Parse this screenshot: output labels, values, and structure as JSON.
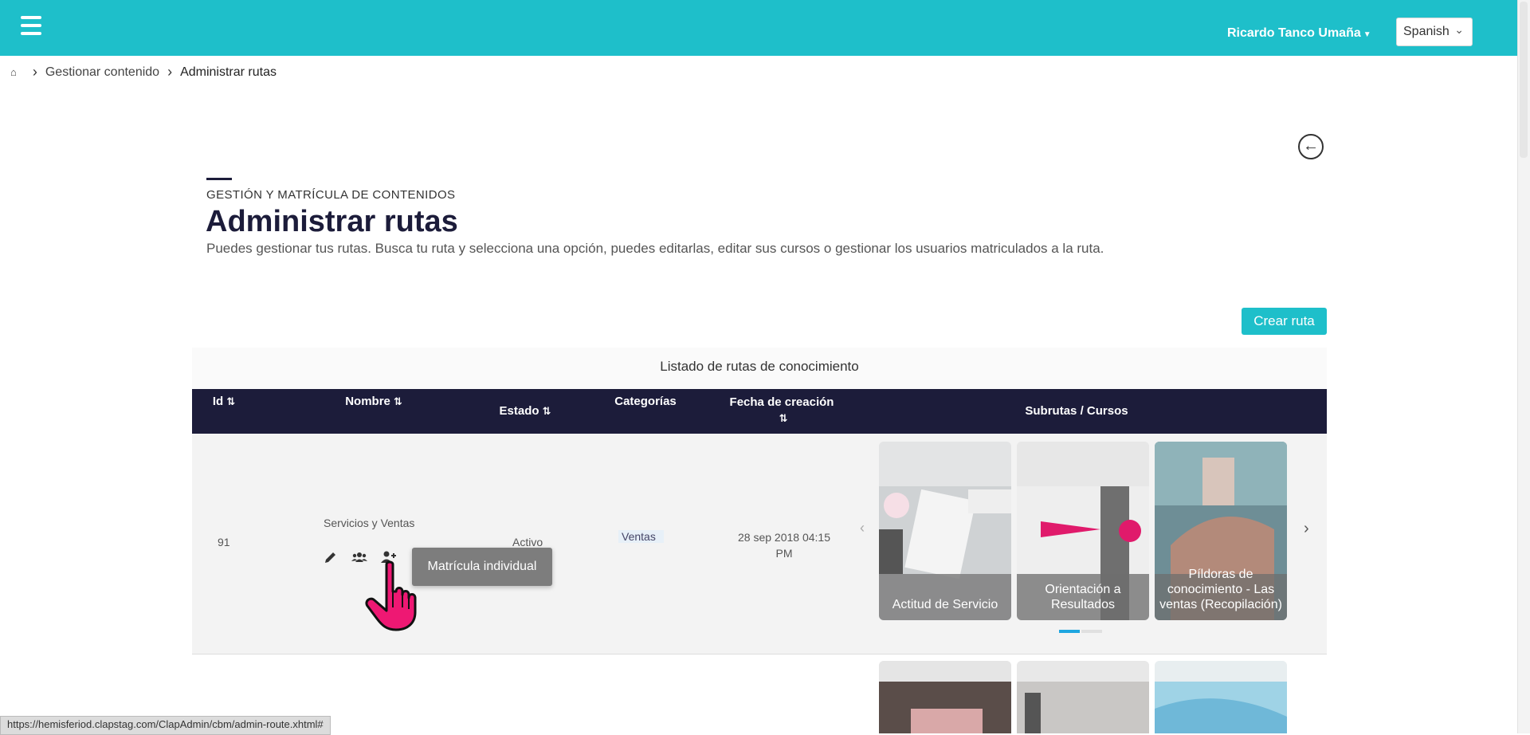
{
  "header": {
    "user_name": "Ricardo Tanco Umaña",
    "language": "Spanish",
    "brand_color": "#1ebfca"
  },
  "breadcrumb": {
    "home_icon": "home-icon",
    "items": [
      "Gestionar contenido",
      "Administrar rutas"
    ]
  },
  "page": {
    "eyebrow": "GESTIÓN Y MATRÍCULA DE CONTENIDOS",
    "title": "Administrar rutas",
    "description": "Puedes gestionar tus rutas. Busca tu ruta y selecciona una opción, puedes editarlas, editar sus cursos o gestionar los usuarios matriculados a la ruta.",
    "create_button": "Crear ruta"
  },
  "table": {
    "caption": "Listado de rutas de conocimiento",
    "columns": {
      "id": "Id",
      "nombre": "Nombre",
      "estado": "Estado",
      "categorias": "Categorías",
      "fecha_line1": "Fecha de creación",
      "subrutas": "Subrutas / Cursos"
    },
    "rows": [
      {
        "id": "91",
        "nombre": "Servicios y Ventas",
        "estado": "Activo",
        "categoria": "Ventas",
        "fecha_line1": "28 sep 2018 04:15",
        "fecha_line2": "PM",
        "tooltip": "Matrícula individual",
        "courses": [
          {
            "title": "Actitud de Servicio"
          },
          {
            "title": "Orientación a Resultados"
          },
          {
            "title": "Píldoras de conocimiento - Las ventas (Recopilación)"
          }
        ],
        "carousel_page": 1,
        "carousel_pages": 2
      }
    ]
  },
  "status_url": "https://hemisferiod.clapstag.com/ClapAdmin/cbm/admin-route.xhtml#"
}
